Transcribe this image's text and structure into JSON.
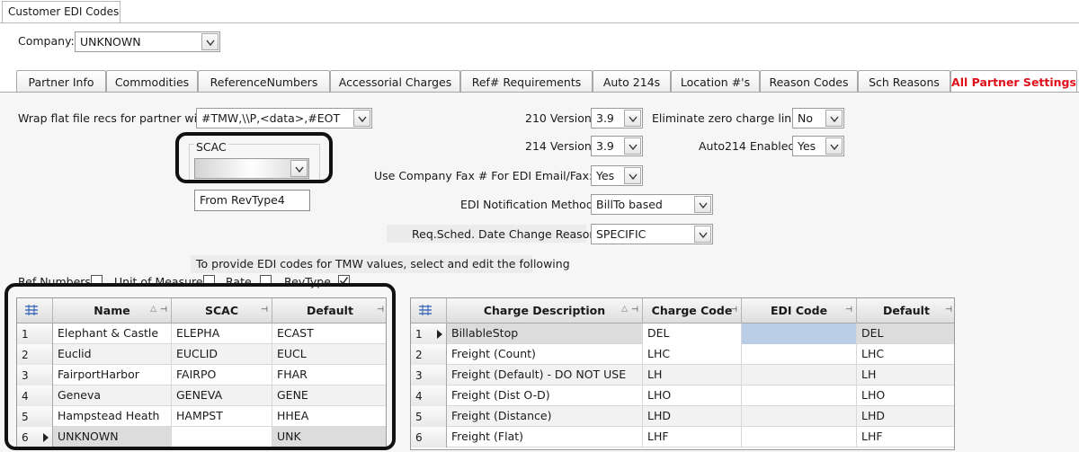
{
  "window": {
    "tab_title": "Customer EDI Codes"
  },
  "company": {
    "label": "Company:",
    "value": "UNKNOWN"
  },
  "tabs": [
    "Partner Info",
    "Commodities",
    "ReferenceNumbers",
    "Accessorial Charges",
    "Ref# Requirements",
    "Auto 214s",
    "Location #'s",
    "Reason Codes",
    "Sch Reasons",
    "All Partner Settings"
  ],
  "active_tab": "All Partner Settings",
  "settings": {
    "wrap_label": "Wrap flat file recs for partner with:",
    "wrap_value": "#TMW,\\\\P,<data>,#EOT",
    "scac_label": "SCAC",
    "scac_value": "",
    "rev_type_value": "From RevType4",
    "v210_label": "210 Version:",
    "v210_value": "3.9",
    "v214_label": "214 Version:",
    "v214_value": "3.9",
    "fax_label": "Use Company Fax # For EDI Email/Fax:",
    "fax_value": "Yes",
    "notif_label": "EDI Notification Method:",
    "notif_value": "BillTo based",
    "reason_label": "Req.Sched. Date Change Reason:",
    "reason_value": "SPECIFIC",
    "zero_label": "Eliminate zero charge lines:",
    "zero_value": "No",
    "auto214_label": "Auto214 Enabled:",
    "auto214_value": "Yes"
  },
  "edi_hint": "To provide EDI codes for TMW values, select and edit the following",
  "checkboxes": [
    {
      "label": "Ref Numbers",
      "checked": false
    },
    {
      "label": "Unit of Measure",
      "checked": false
    },
    {
      "label": "Rate",
      "checked": false
    },
    {
      "label": "RevType",
      "checked": true
    }
  ],
  "left_grid": {
    "columns": [
      "Name",
      "SCAC",
      "Default"
    ],
    "rows": [
      {
        "num": "1",
        "name": "Elephant & Castle",
        "scac": "ELEPHA",
        "default": "ECAST"
      },
      {
        "num": "2",
        "name": "Euclid",
        "scac": "EUCLID",
        "default": "EUCL"
      },
      {
        "num": "3",
        "name": "FairportHarbor",
        "scac": "FAIRPO",
        "default": "FHAR"
      },
      {
        "num": "4",
        "name": "Geneva",
        "scac": "GENEVA",
        "default": "GENE"
      },
      {
        "num": "5",
        "name": "Hampstead Heath",
        "scac": "HAMPST",
        "default": "HHEA"
      },
      {
        "num": "6",
        "name": "UNKNOWN",
        "scac": "",
        "default": "UNK"
      }
    ]
  },
  "right_grid": {
    "columns": [
      "Charge Description",
      "Charge Code",
      "EDI Code",
      "Default"
    ],
    "rows": [
      {
        "num": "1",
        "desc": "BillableStop",
        "code": "DEL",
        "edi": "",
        "default": "DEL"
      },
      {
        "num": "2",
        "desc": "Freight (Count)",
        "code": "LHC",
        "edi": "",
        "default": "LHC"
      },
      {
        "num": "3",
        "desc": "Freight (Default) - DO NOT USE",
        "code": "LH",
        "edi": "",
        "default": "LH"
      },
      {
        "num": "4",
        "desc": "Freight (Dist O-D)",
        "code": "LHO",
        "edi": "",
        "default": "LHO"
      },
      {
        "num": "5",
        "desc": "Freight (Distance)",
        "code": "LHD",
        "edi": "",
        "default": "LHD"
      },
      {
        "num": "6",
        "desc": "Freight (Flat)",
        "code": "LHF",
        "edi": "",
        "default": "LHF"
      }
    ]
  }
}
